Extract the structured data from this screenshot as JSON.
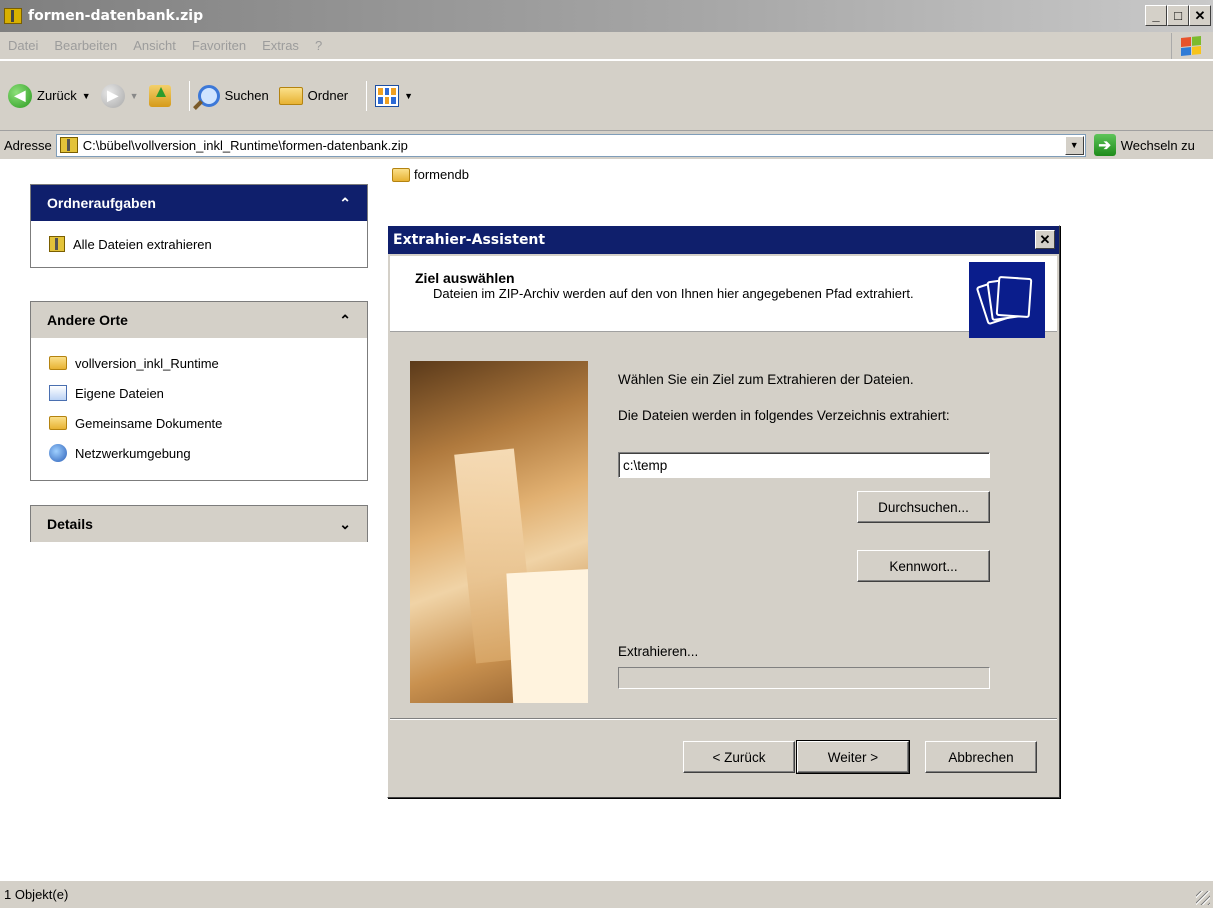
{
  "window": {
    "title": "formen-datenbank.zip",
    "controls": {
      "minimize": "_",
      "maximize": "□",
      "close": "✕"
    }
  },
  "menu": {
    "items": [
      "Datei",
      "Bearbeiten",
      "Ansicht",
      "Favoriten",
      "Extras",
      "?"
    ]
  },
  "toolbar": {
    "back_label": "Zurück",
    "search_label": "Suchen",
    "folders_label": "Ordner"
  },
  "address": {
    "label": "Adresse",
    "value": "C:\\bübel\\vollversion_inkl_Runtime\\formen-datenbank.zip",
    "go_label": "Wechseln zu"
  },
  "taskpane": {
    "ordneraufgaben": {
      "title": "Ordneraufgaben",
      "items": [
        {
          "label": "Alle Dateien extrahieren",
          "icon": "zip-folder-icon"
        }
      ]
    },
    "andere_orte": {
      "title": "Andere Orte",
      "items": [
        {
          "label": "vollversion_inkl_Runtime",
          "icon": "folder-icon"
        },
        {
          "label": "Eigene Dateien",
          "icon": "my-documents-icon"
        },
        {
          "label": "Gemeinsame Dokumente",
          "icon": "folder-icon"
        },
        {
          "label": "Netzwerkumgebung",
          "icon": "network-icon"
        }
      ]
    },
    "details": {
      "title": "Details"
    }
  },
  "files": [
    {
      "name": "formendb",
      "icon": "folder-icon"
    }
  ],
  "dialog": {
    "title": "Extrahier-Assistent",
    "heading": "Ziel auswählen",
    "subtitle": "Dateien im ZIP-Archiv werden auf den von Ihnen hier angegebenen Pfad extrahiert.",
    "prompt": "Wählen Sie ein Ziel zum Extrahieren der Dateien.",
    "dir_label": "Die Dateien werden in folgendes Verzeichnis extrahiert:",
    "dir_value": "c:\\temp",
    "browse_label": "Durchsuchen...",
    "password_label": "Kennwort...",
    "progress_label": "Extrahieren...",
    "progress": 0,
    "back_label": "< Zurück",
    "next_label": "Weiter >",
    "cancel_label": "Abbrechen"
  },
  "status": {
    "text": "1 Objekt(e)"
  },
  "colors": {
    "titlebar_inactive": "#a0a0a0",
    "taskpane_header": "#0f1f6c",
    "dialog_title": "#0f1f6c",
    "chrome": "#d4d0c8"
  }
}
